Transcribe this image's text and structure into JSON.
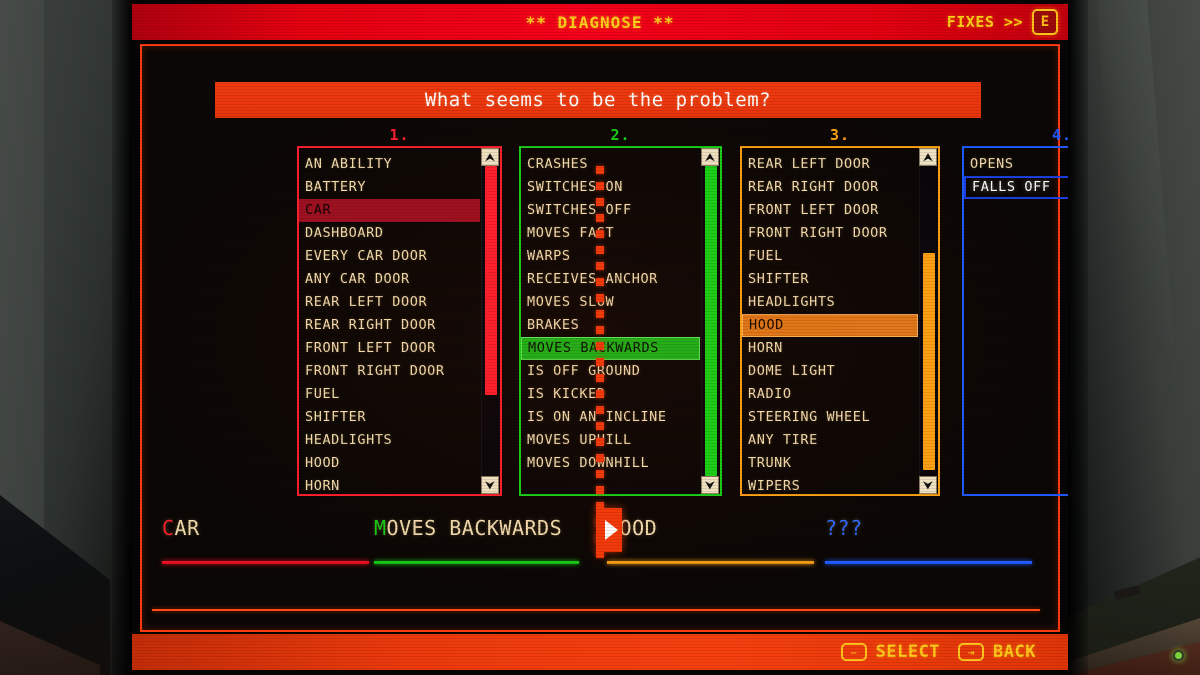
{
  "header": {
    "title": "** DIAGNOSE **",
    "fixes_label": "FIXES >>",
    "fixes_key": "E"
  },
  "question": "What seems to be the problem?",
  "columns": [
    {
      "number": "1.",
      "color": "#ff1f2e",
      "selected": "CAR",
      "scroll_thumb_top_pct": 0,
      "scroll_thumb_height_pct": 74,
      "items": [
        "AN ABILITY",
        "BATTERY",
        "CAR",
        "DASHBOARD",
        "EVERY CAR DOOR",
        "ANY CAR DOOR",
        "REAR LEFT DOOR",
        "REAR RIGHT DOOR",
        "FRONT LEFT DOOR",
        "FRONT RIGHT DOOR",
        "FUEL",
        "SHIFTER",
        "HEADLIGHTS",
        "HOOD",
        "HORN"
      ]
    },
    {
      "number": "2.",
      "color": "#17d117",
      "selected": "MOVES BACKWARDS",
      "scroll_thumb_top_pct": 0,
      "scroll_thumb_height_pct": 100,
      "items": [
        "CRASHES",
        "SWITCHES ON",
        "SWITCHES OFF",
        "MOVES FAST",
        "WARPS",
        "RECEIVES ANCHOR",
        "MOVES SLOW",
        "BRAKES",
        "MOVES BACKWARDS",
        "IS OFF GROUND",
        "IS KICKED",
        "IS ON AN INCLINE",
        "MOVES UPHILL",
        "MOVES DOWNHILL"
      ]
    },
    {
      "number": "3.",
      "color": "#ffa114",
      "selected": "HOOD",
      "scroll_thumb_top_pct": 28,
      "scroll_thumb_height_pct": 70,
      "items": [
        "REAR LEFT DOOR",
        "REAR RIGHT DOOR",
        "FRONT LEFT DOOR",
        "FRONT RIGHT DOOR",
        "FUEL",
        "SHIFTER",
        "HEADLIGHTS",
        "HOOD",
        "HORN",
        "DOME LIGHT",
        "RADIO",
        "STEERING WHEEL",
        "ANY TIRE",
        "TRUNK",
        "WIPERS"
      ]
    },
    {
      "number": "4.",
      "color": "#1f5bff",
      "cursor": "FALLS OFF",
      "scroll_thumb_top_pct": 0,
      "scroll_thumb_height_pct": 100,
      "items": [
        "OPENS",
        "FALLS OFF"
      ]
    }
  ],
  "summary": [
    {
      "text": "CAR",
      "accent": "#ff1f2e",
      "line": "#e81020"
    },
    {
      "text": "MOVES BACKWARDS",
      "accent": "#17d117",
      "line": "#15c615"
    },
    {
      "text": "HOOD",
      "accent": "#ffa114",
      "line": "#f09a14"
    },
    {
      "text": "???",
      "accent": "#2f6bff",
      "line": "#1f5bff",
      "all_accent": true
    }
  ],
  "footer": {
    "select_label": "SELECT",
    "select_icon": "enter-key-icon",
    "back_label": "BACK",
    "back_icon": "tab-key-icon"
  }
}
